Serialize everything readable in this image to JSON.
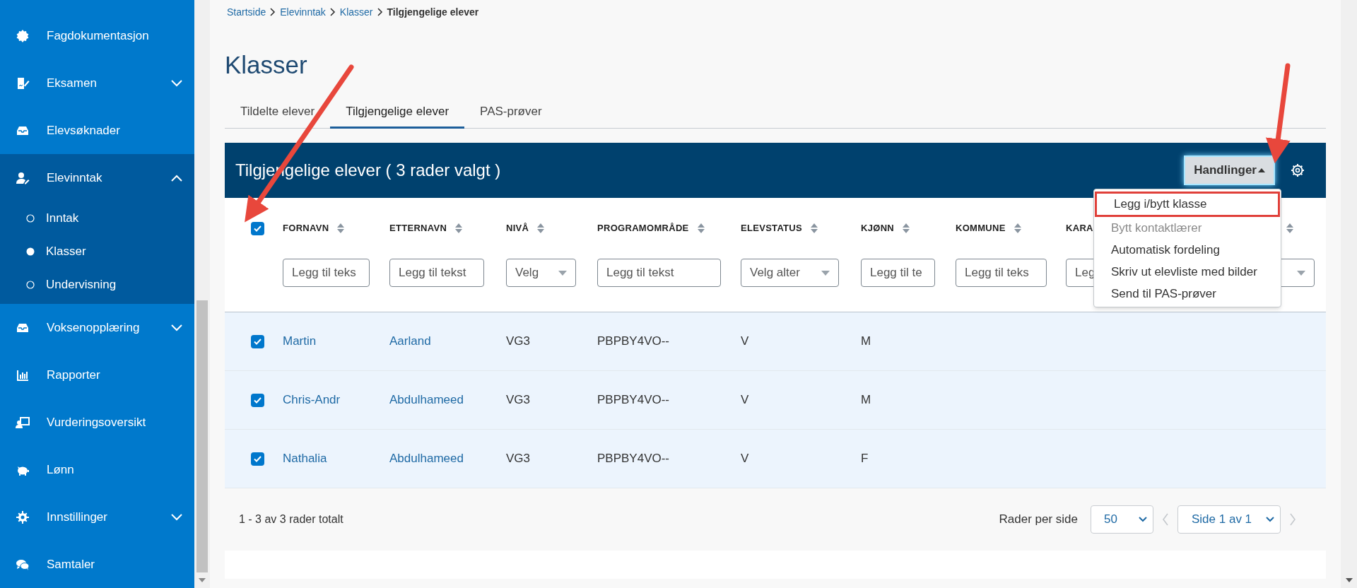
{
  "sidebar": {
    "items": [
      {
        "label": "Fagdokumentasjon",
        "chevron": false,
        "expanded": false
      },
      {
        "label": "Eksamen",
        "chevron": true,
        "expanded": false
      },
      {
        "label": "Elevsøknader",
        "chevron": false,
        "expanded": false
      },
      {
        "label": "Elevinntak",
        "chevron": true,
        "expanded": true,
        "children": [
          {
            "label": "Inntak",
            "selected": false
          },
          {
            "label": "Klasser",
            "selected": true
          },
          {
            "label": "Undervisning",
            "selected": false
          }
        ]
      },
      {
        "label": "Voksenopplæring",
        "chevron": true,
        "expanded": false
      },
      {
        "label": "Rapporter",
        "chevron": false,
        "expanded": false
      },
      {
        "label": "Vurderingsoversikt",
        "chevron": false,
        "expanded": false
      },
      {
        "label": "Lønn",
        "chevron": false,
        "expanded": false
      },
      {
        "label": "Innstillinger",
        "chevron": true,
        "expanded": false
      },
      {
        "label": "Samtaler",
        "chevron": false,
        "expanded": false
      }
    ]
  },
  "breadcrumb": [
    {
      "label": "Startside",
      "current": false
    },
    {
      "label": "Elevinntak",
      "current": false
    },
    {
      "label": "Klasser",
      "current": false
    },
    {
      "label": "Tilgjengelige elever",
      "current": true
    }
  ],
  "title": "Klasser",
  "tabs": [
    {
      "label": "Tildelte elever",
      "selected": false
    },
    {
      "label": "Tilgjengelige elever",
      "selected": true
    },
    {
      "label": "PAS-prøver",
      "selected": false
    }
  ],
  "table": {
    "title": "Tilgjengelige elever ( 3 rader valgt )",
    "actions_button": "Handlinger",
    "select_all": {
      "checked": true
    },
    "columns": [
      {
        "label": "FORNAVN",
        "link": true,
        "filter": {
          "kind": "text",
          "placeholder": "Legg til teks"
        }
      },
      {
        "label": "ETTERNAVN",
        "link": true,
        "filter": {
          "kind": "text",
          "placeholder": "Legg til tekst"
        }
      },
      {
        "label": "NIVÅ",
        "link": false,
        "filter": {
          "kind": "select",
          "placeholder": "Velg"
        }
      },
      {
        "label": "PROGRAMOMRÅDE",
        "link": false,
        "filter": {
          "kind": "text",
          "placeholder": "Legg til tekst"
        }
      },
      {
        "label": "ELEVSTATUS",
        "link": false,
        "filter": {
          "kind": "select",
          "placeholder": "Velg alter"
        }
      },
      {
        "label": "KJØNN",
        "link": false,
        "filter": {
          "kind": "text",
          "placeholder": "Legg til te"
        }
      },
      {
        "label": "KOMMUNE",
        "filter": {
          "kind": "text",
          "placeholder": "Legg til teks"
        }
      },
      {
        "label": "KARA",
        "filter": {
          "kind": "text",
          "placeholder": "Leg"
        }
      },
      {
        "filter": {
          "kind": "select"
        }
      }
    ],
    "rows": [
      {
        "selected": true,
        "cells": [
          "Martin",
          "Aarland",
          "VG3",
          "PBPBY4VO--",
          "V",
          "M"
        ]
      },
      {
        "selected": true,
        "cells": [
          "Chris-Andr",
          "Abdulhameed",
          "VG3",
          "PBPBY4VO--",
          "V",
          "M"
        ]
      },
      {
        "selected": true,
        "cells": [
          "Nathalia",
          "Abdulhameed",
          "VG3",
          "PBPBY4VO--",
          "V",
          "F"
        ]
      }
    ],
    "actions_menu": [
      {
        "label": "Legg i/bytt klasse",
        "disabled": false,
        "highlighted": true
      },
      {
        "label": "Bytt kontaktlærer",
        "disabled": true,
        "highlighted": false
      },
      {
        "label": "Automatisk fordeling",
        "disabled": false,
        "highlighted": false
      },
      {
        "label": "Skriv ut elevliste med bilder",
        "disabled": false,
        "highlighted": false
      },
      {
        "label": "Send til PAS-prøver",
        "disabled": false,
        "highlighted": false
      }
    ]
  },
  "footer": {
    "summary": "1 - 3 av 3 rader totalt",
    "rows_per_page_label": "Rader per side",
    "page_size": "50",
    "page": "Side 1 av 1",
    "prev_enabled": false,
    "next_enabled": false
  }
}
